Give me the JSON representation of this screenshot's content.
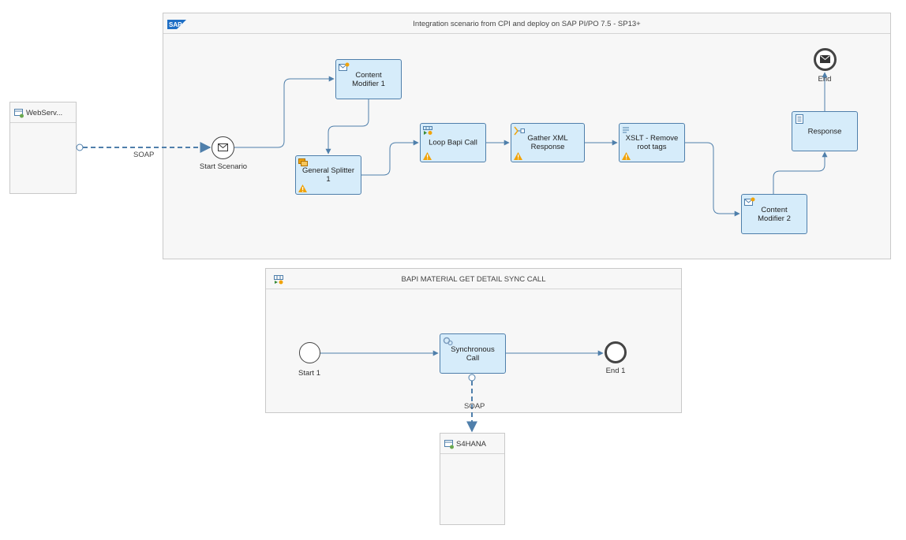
{
  "pools": {
    "integration": {
      "title": "Integration scenario from CPI and deploy on SAP PI/PO 7.5 - SP13+",
      "logo_text": "SAP"
    },
    "bapi": {
      "title": "BAPI MATERIAL GET DETAIL SYNC CALL"
    }
  },
  "participants": {
    "sender": "WebServ...",
    "receiver": "S4HANA"
  },
  "tasks": {
    "content_modifier_1": "Content\nModifier 1",
    "general_splitter": "General Splitter\n1",
    "loop_bapi": "Loop Bapi Call",
    "gather": "Gather XML\nResponse",
    "xslt": "XSLT - Remove\nroot tags",
    "content_modifier_2": "Content\nModifier 2",
    "response": "Response",
    "sync_call": "Synchronous\nCall"
  },
  "events": {
    "start_scenario": "Start Scenario",
    "end": "End",
    "start_1": "Start 1",
    "end_1": "End 1"
  },
  "connections": {
    "soap_sender": "SOAP",
    "soap_receiver": "SOAP"
  },
  "colors": {
    "task_fill": "#d6ecfa",
    "task_border": "#4f7fab",
    "edge": "#4f7fab",
    "warning": "#f0a30a",
    "pool_fill": "#f7f7f7",
    "sap_blue": "#1f6fc5"
  }
}
